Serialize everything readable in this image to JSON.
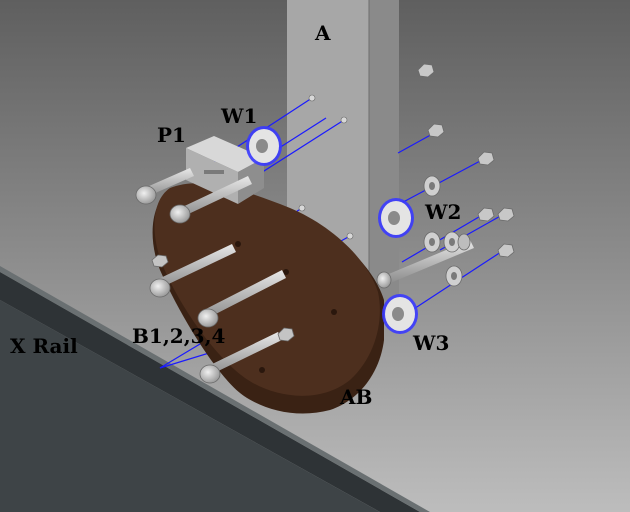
{
  "labels": {
    "a": "A",
    "w1": "W1",
    "p1": "P1",
    "w2": "W2",
    "b": "B1,2,3,4",
    "w3": "W3",
    "x_rail": "X Rail",
    "ab": "AB"
  },
  "colors": {
    "background_light": "#b9b9b9",
    "background_dark": "#5a5a5a",
    "plate": "#4a2d1c",
    "plate_edge": "#3a2214",
    "rail": "#3a3f42",
    "column": "#a6a6a6",
    "bolt": "#c9c9c9",
    "axis_line": "#1a1aff"
  }
}
